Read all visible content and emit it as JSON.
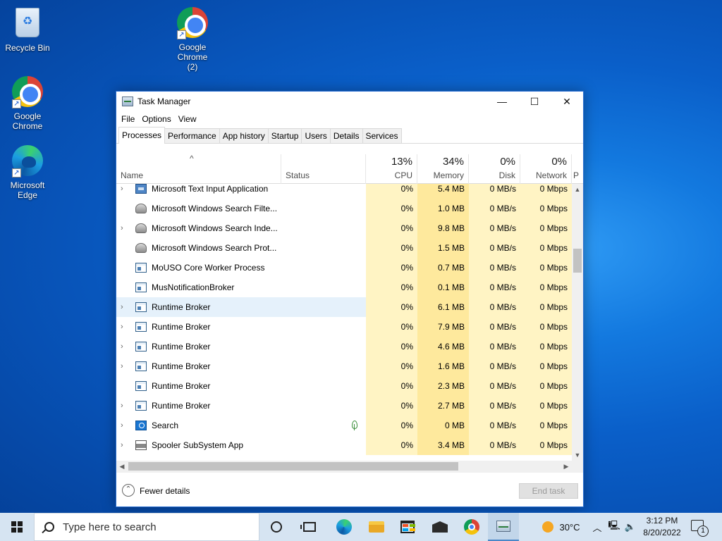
{
  "desktop": {
    "icons": [
      {
        "label": "Recycle Bin",
        "icon": "recycle-bin-icon"
      },
      {
        "label": "Google Chrome (2)",
        "icon": "chrome-icon"
      },
      {
        "label": "Google Chrome",
        "icon": "chrome-icon"
      },
      {
        "label": "Microsoft Edge",
        "icon": "edge-icon"
      }
    ]
  },
  "window": {
    "title": "Task Manager",
    "controls": {
      "minimize": "—",
      "maximize": "☐",
      "close": "✕"
    },
    "menu": [
      "File",
      "Options",
      "View"
    ],
    "tabs": [
      "Processes",
      "Performance",
      "App history",
      "Startup",
      "Users",
      "Details",
      "Services"
    ],
    "active_tab": "Processes",
    "columns": {
      "name": "Name",
      "status": "Status",
      "cpu": {
        "label": "CPU",
        "pct": "13%"
      },
      "memory": {
        "label": "Memory",
        "pct": "34%"
      },
      "disk": {
        "label": "Disk",
        "pct": "0%"
      },
      "network": {
        "label": "Network",
        "pct": "0%"
      },
      "power": "P"
    },
    "sort_indicator": "^",
    "rows": [
      {
        "expand": "›",
        "icon": "keyboard-app-icon",
        "name": "Microsoft Text Input Application",
        "status": "",
        "cpu": "0%",
        "memory": "5.4 MB",
        "disk": "0 MB/s",
        "network": "0 Mbps"
      },
      {
        "expand": "",
        "icon": "user-service-icon",
        "name": "Microsoft Windows Search Filte...",
        "status": "",
        "cpu": "0%",
        "memory": "1.0 MB",
        "disk": "0 MB/s",
        "network": "0 Mbps"
      },
      {
        "expand": "›",
        "icon": "user-service-icon",
        "name": "Microsoft Windows Search Inde...",
        "status": "",
        "cpu": "0%",
        "memory": "9.8 MB",
        "disk": "0 MB/s",
        "network": "0 Mbps"
      },
      {
        "expand": "",
        "icon": "user-service-icon",
        "name": "Microsoft Windows Search Prot...",
        "status": "",
        "cpu": "0%",
        "memory": "1.5 MB",
        "disk": "0 MB/s",
        "network": "0 Mbps"
      },
      {
        "expand": "",
        "icon": "app-window-icon",
        "name": "MoUSO Core Worker Process",
        "status": "",
        "cpu": "0%",
        "memory": "0.7 MB",
        "disk": "0 MB/s",
        "network": "0 Mbps"
      },
      {
        "expand": "",
        "icon": "app-window-icon",
        "name": "MusNotificationBroker",
        "status": "",
        "cpu": "0%",
        "memory": "0.1 MB",
        "disk": "0 MB/s",
        "network": "0 Mbps"
      },
      {
        "expand": "›",
        "icon": "app-window-icon",
        "name": "Runtime Broker",
        "status": "",
        "cpu": "0%",
        "memory": "6.1 MB",
        "disk": "0 MB/s",
        "network": "0 Mbps",
        "highlight": true
      },
      {
        "expand": "›",
        "icon": "app-window-icon",
        "name": "Runtime Broker",
        "status": "",
        "cpu": "0%",
        "memory": "7.9 MB",
        "disk": "0 MB/s",
        "network": "0 Mbps"
      },
      {
        "expand": "›",
        "icon": "app-window-icon",
        "name": "Runtime Broker",
        "status": "",
        "cpu": "0%",
        "memory": "4.6 MB",
        "disk": "0 MB/s",
        "network": "0 Mbps"
      },
      {
        "expand": "›",
        "icon": "app-window-icon",
        "name": "Runtime Broker",
        "status": "",
        "cpu": "0%",
        "memory": "1.6 MB",
        "disk": "0 MB/s",
        "network": "0 Mbps"
      },
      {
        "expand": "",
        "icon": "app-window-icon",
        "name": "Runtime Broker",
        "status": "",
        "cpu": "0%",
        "memory": "2.3 MB",
        "disk": "0 MB/s",
        "network": "0 Mbps"
      },
      {
        "expand": "›",
        "icon": "app-window-icon",
        "name": "Runtime Broker",
        "status": "",
        "cpu": "0%",
        "memory": "2.7 MB",
        "disk": "0 MB/s",
        "network": "0 Mbps"
      },
      {
        "expand": "›",
        "icon": "search-app-icon",
        "name": "Search",
        "status": "",
        "status_icon": "leaf-icon",
        "cpu": "0%",
        "memory": "0 MB",
        "disk": "0 MB/s",
        "network": "0 Mbps"
      },
      {
        "expand": "›",
        "icon": "printer-icon",
        "name": "Spooler SubSystem App",
        "status": "",
        "cpu": "0%",
        "memory": "3.4 MB",
        "disk": "0 MB/s",
        "network": "0 Mbps"
      }
    ],
    "footer": {
      "fewer_details": "Fewer details",
      "end_task": "End task"
    }
  },
  "taskbar": {
    "search_placeholder": "Type here to search",
    "weather": "30°C",
    "time": "3:12 PM",
    "date": "8/20/2022",
    "notification_count": "1",
    "tray_icons": [
      "chevron-up-icon",
      "network-icon",
      "volume-icon"
    ]
  }
}
